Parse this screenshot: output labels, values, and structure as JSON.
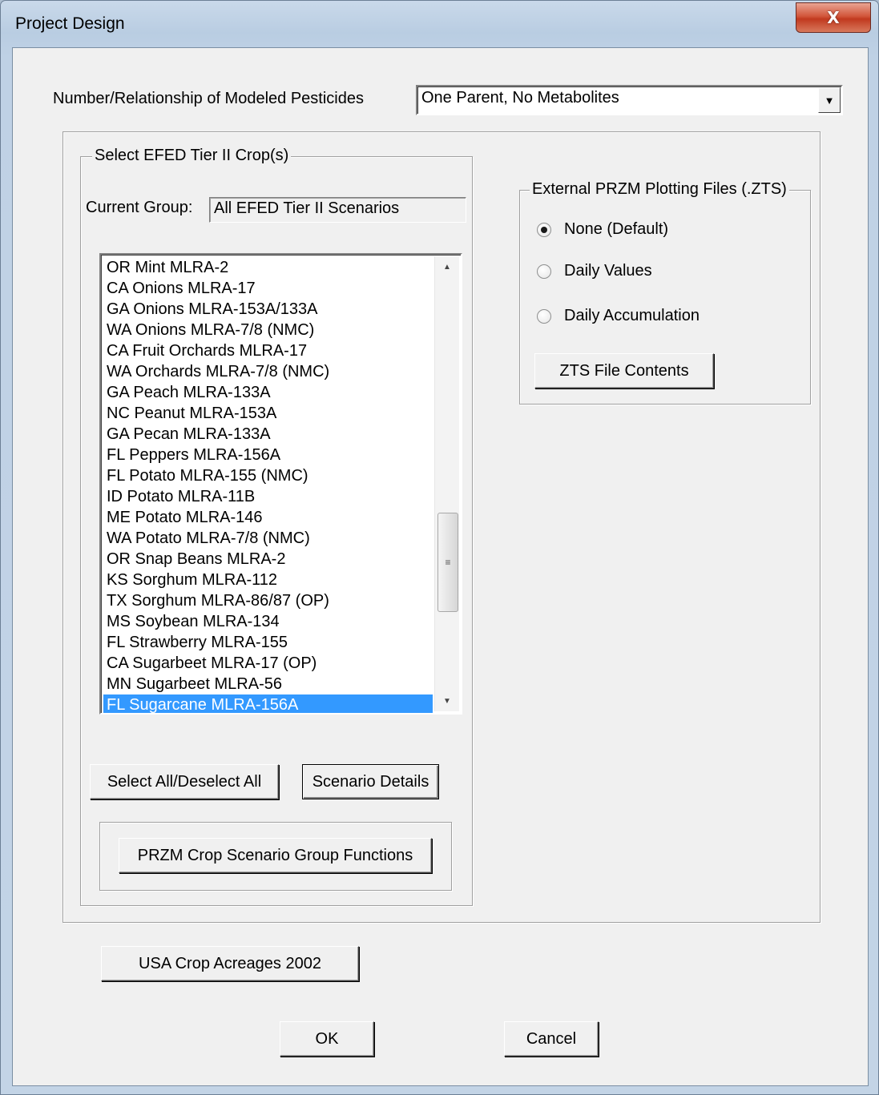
{
  "window": {
    "title": "Project Design",
    "close_glyph": "X"
  },
  "pesticides": {
    "label": "Number/Relationship of Modeled Pesticides",
    "selected": "One Parent, No Metabolites",
    "arrow_glyph": "▼"
  },
  "crop_group": {
    "title": "Select EFED Tier II Crop(s)",
    "current_group_label": "Current Group:",
    "current_group_value": "All EFED Tier II Scenarios",
    "items": [
      "OR Mint  MLRA-2",
      "CA Onions MLRA-17",
      "GA Onions MLRA-153A/133A",
      "WA Onions MLRA-7/8 (NMC)",
      "CA Fruit Orchards MLRA-17",
      "WA Orchards MLRA-7/8 (NMC)",
      "GA Peach  MLRA-133A",
      "NC Peanut  MLRA-153A",
      "GA Pecan  MLRA-133A",
      "FL Peppers MLRA-156A",
      "FL Potato MLRA-155 (NMC)",
      "ID Potato  MLRA-11B",
      "ME Potato  MLRA-146",
      "WA Potato MLRA-7/8 (NMC)",
      "OR Snap Beans MLRA-2",
      "KS Sorghum  MLRA-112",
      "TX Sorghum  MLRA-86/87 (OP)",
      "MS Soybean  MLRA-134",
      "FL Strawberry  MLRA-155",
      "CA Sugarbeet  MLRA-17  (OP)",
      "MN Sugarbeet  MLRA-56",
      "FL Sugarcane  MLRA-156A"
    ],
    "selected_index": 21,
    "select_all_label": "Select All/Deselect All",
    "scenario_details_label": "Scenario Details",
    "group_functions_label": "PRZM Crop Scenario Group Functions"
  },
  "zts": {
    "title": "External PRZM Plotting Files (.ZTS)",
    "options": [
      {
        "label": "None (Default)",
        "checked": true
      },
      {
        "label": "Daily Values",
        "checked": false
      },
      {
        "label": "Daily Accumulation",
        "checked": false
      }
    ],
    "contents_button": "ZTS File Contents"
  },
  "acreage_button": "USA Crop Acreages 2002",
  "ok_label": "OK",
  "cancel_label": "Cancel",
  "scroll": {
    "up_glyph": "▲",
    "down_glyph": "▼",
    "thumb_glyph": "≡"
  }
}
